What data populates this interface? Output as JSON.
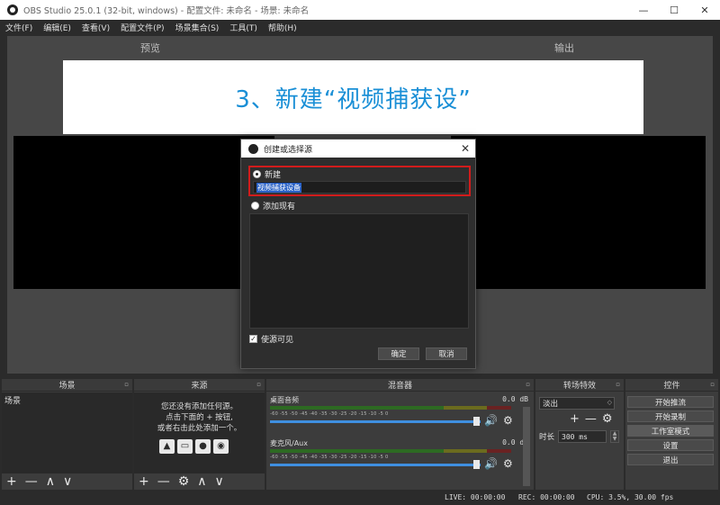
{
  "window": {
    "title": "OBS Studio 25.0.1 (32-bit, windows) - 配置文件: 未命名 - 场景: 未命名",
    "minimize": "—",
    "maximize": "☐",
    "close": "✕"
  },
  "menu": [
    "文件(F)",
    "编辑(E)",
    "查看(V)",
    "配置文件(P)",
    "场景集合(S)",
    "工具(T)",
    "帮助(H)"
  ],
  "workspace": {
    "preview_label": "预览",
    "output_label": "输出"
  },
  "banner": {
    "text": "3、新建“视频捕获设”"
  },
  "dialog": {
    "title": "创建或选择源",
    "close": "✕",
    "new_label": "新建",
    "name_value": "视频捕获设备",
    "existing_label": "添加现有",
    "visible_label": "使源可见",
    "visible_checked": true,
    "ok_label": "确定",
    "cancel_label": "取消"
  },
  "scenes": {
    "header": "场景",
    "items": [
      "场景"
    ],
    "footer": [
      "+",
      "—",
      "∧",
      "∨"
    ]
  },
  "sources": {
    "header": "来源",
    "empty_line1": "您还没有添加任何源。",
    "empty_line2": "点击下面的 + 按钮,",
    "empty_line3": "或者右击此处添加一个。",
    "footer": [
      "+",
      "—",
      "⚙",
      "∧",
      "∨"
    ]
  },
  "mixer": {
    "header": "混音器",
    "channels": [
      {
        "name": "桌面音频",
        "db": "0.0 dB"
      },
      {
        "name": "麦克风/Aux",
        "db": "0.0 dB"
      }
    ],
    "scale": "-60 -55 -50 -45 -40 -35 -30 -25 -20 -15 -10 -5 0"
  },
  "transitions": {
    "header": "转场特效",
    "type": "淡出",
    "duration_label": "时长",
    "duration_value": "300 ms"
  },
  "controls": {
    "header": "控件",
    "buttons": [
      "开始推流",
      "开始录制",
      "工作室模式",
      "设置",
      "退出"
    ]
  },
  "status": {
    "live": "LIVE: 00:00:00",
    "rec": "REC: 00:00:00",
    "cpu": "CPU: 3.5%, 30.00 fps"
  },
  "icons": {
    "dock_float": "▫",
    "speaker": "🔊",
    "gear": "⚙"
  }
}
